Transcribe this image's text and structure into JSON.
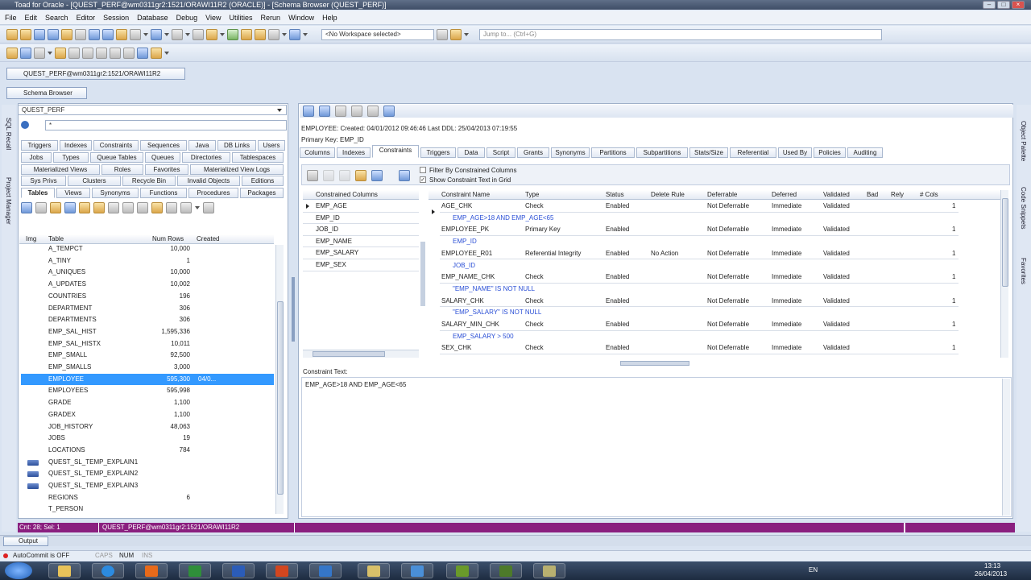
{
  "window": {
    "title": "Toad for Oracle - [QUEST_PERF@wm0311gr2:1521/ORAWI11R2 (ORACLE)] - [Schema Browser (QUEST_PERF)]"
  },
  "menu": [
    "File",
    "Edit",
    "Search",
    "Editor",
    "Session",
    "Database",
    "Debug",
    "View",
    "Utilities",
    "Rerun",
    "Window",
    "Help"
  ],
  "toolbar": {
    "workspace": "<No Workspace selected>",
    "jump_placeholder": "Jump to... (Ctrl+G)"
  },
  "connection_tab": "QUEST_PERF@wm0311gr2:1521/ORAWI11R2",
  "schema_browser_tab": "Schema Browser",
  "left": {
    "schema": "QUEST_PERF",
    "filter": "*",
    "obj_tabs_row1": [
      "Triggers",
      "Indexes",
      "Constraints",
      "Sequences",
      "Java",
      "DB Links",
      "Users"
    ],
    "obj_tabs_row2": [
      "Jobs",
      "Types",
      "Queue Tables",
      "Queues",
      "Directories",
      "Tablespaces"
    ],
    "obj_tabs_row3": [
      "Materialized Views",
      "Roles",
      "Favorites",
      "Materialized View Logs"
    ],
    "obj_tabs_row4": [
      "Sys Privs",
      "Clusters",
      "Recycle Bin",
      "Invalid Objects",
      "Editions"
    ],
    "obj_tabs_row5": [
      "Tables",
      "Views",
      "Synonyms",
      "Functions",
      "Procedures",
      "Packages"
    ],
    "cols": {
      "img": "Img",
      "table": "Table",
      "rows": "Num Rows",
      "created": "Created"
    },
    "tables": [
      {
        "name": "A_TEMPCT",
        "rows": "10,000",
        "created": ""
      },
      {
        "name": "A_TINY",
        "rows": "1",
        "created": ""
      },
      {
        "name": "A_UNIQUES",
        "rows": "10,000",
        "created": ""
      },
      {
        "name": "A_UPDATES",
        "rows": "10,002",
        "created": ""
      },
      {
        "name": "COUNTRIES",
        "rows": "196",
        "created": ""
      },
      {
        "name": "DEPARTMENT",
        "rows": "306",
        "created": ""
      },
      {
        "name": "DEPARTMENTS",
        "rows": "306",
        "created": ""
      },
      {
        "name": "EMP_SAL_HIST",
        "rows": "1,595,336",
        "created": ""
      },
      {
        "name": "EMP_SAL_HISTX",
        "rows": "10,011",
        "created": ""
      },
      {
        "name": "EMP_SMALL",
        "rows": "92,500",
        "created": ""
      },
      {
        "name": "EMP_SMALLS",
        "rows": "3,000",
        "created": ""
      },
      {
        "name": "EMPLOYEE",
        "rows": "595,300",
        "created": "04/0..."
      },
      {
        "name": "EMPLOYEES",
        "rows": "595,998",
        "created": ""
      },
      {
        "name": "GRADE",
        "rows": "1,100",
        "created": ""
      },
      {
        "name": "GRADEX",
        "rows": "1,100",
        "created": ""
      },
      {
        "name": "JOB_HISTORY",
        "rows": "48,063",
        "created": ""
      },
      {
        "name": "JOBS",
        "rows": "19",
        "created": ""
      },
      {
        "name": "LOCATIONS",
        "rows": "784",
        "created": ""
      },
      {
        "name": "QUEST_SL_TEMP_EXPLAIN1",
        "rows": "",
        "created": ""
      },
      {
        "name": "QUEST_SL_TEMP_EXPLAIN2",
        "rows": "",
        "created": ""
      },
      {
        "name": "QUEST_SL_TEMP_EXPLAIN3",
        "rows": "",
        "created": ""
      },
      {
        "name": "REGIONS",
        "rows": "6",
        "created": ""
      },
      {
        "name": "T_PERSON",
        "rows": "",
        "created": ""
      }
    ]
  },
  "right": {
    "info1": "EMPLOYEE:   Created: 04/01/2012 09:46:46   Last DDL: 25/04/2013 07:19:55",
    "info2": "Primary Key:  EMP_ID",
    "tabs": [
      "Columns",
      "Indexes",
      "Constraints",
      "Triggers",
      "Data",
      "Script",
      "Grants",
      "Synonyms",
      "Partitions",
      "Subpartitions",
      "Stats/Size",
      "Referential",
      "Used By",
      "Policies",
      "Auditing"
    ],
    "filter_label": "Filter By Constrained Columns",
    "show_text_label": "Show Constraint Text in Grid",
    "constrained_header": "Constrained Columns",
    "constrained_cols": [
      "EMP_AGE",
      "EMP_ID",
      "JOB_ID",
      "EMP_NAME",
      "EMP_SALARY",
      "EMP_SEX"
    ],
    "headers": {
      "name": "Constraint Name",
      "type": "Type",
      "status": "Status",
      "delete": "Delete Rule",
      "deferrable": "Deferrable",
      "deferred": "Deferred",
      "validated": "Validated",
      "bad": "Bad",
      "rely": "Rely",
      "cols": "# Cols"
    },
    "constraints": [
      {
        "name": "AGE_CHK",
        "type": "Check",
        "status": "Enabled",
        "delete": "",
        "deferrable": "Not Deferrable",
        "deferred": "Immediate",
        "validated": "Validated",
        "cols": "1",
        "text": "EMP_AGE>18 AND EMP_AGE<65"
      },
      {
        "name": "EMPLOYEE_PK",
        "type": "Primary Key",
        "status": "Enabled",
        "delete": "",
        "deferrable": "Not Deferrable",
        "deferred": "Immediate",
        "validated": "Validated",
        "cols": "1",
        "text": "EMP_ID"
      },
      {
        "name": "EMPLOYEE_R01",
        "type": "Referential Integrity",
        "status": "Enabled",
        "delete": "No Action",
        "deferrable": "Not Deferrable",
        "deferred": "Immediate",
        "validated": "Validated",
        "cols": "1",
        "text": "JOB_ID"
      },
      {
        "name": "EMP_NAME_CHK",
        "type": "Check",
        "status": "Enabled",
        "delete": "",
        "deferrable": "Not Deferrable",
        "deferred": "Immediate",
        "validated": "Validated",
        "cols": "1",
        "text": "\"EMP_NAME\" IS NOT NULL"
      },
      {
        "name": "SALARY_CHK",
        "type": "Check",
        "status": "Enabled",
        "delete": "",
        "deferrable": "Not Deferrable",
        "deferred": "Immediate",
        "validated": "Validated",
        "cols": "1",
        "text": "\"EMP_SALARY\" IS NOT NULL"
      },
      {
        "name": "SALARY_MIN_CHK",
        "type": "Check",
        "status": "Enabled",
        "delete": "",
        "deferrable": "Not Deferrable",
        "deferred": "Immediate",
        "validated": "Validated",
        "cols": "1",
        "text": "EMP_SALARY > 500"
      },
      {
        "name": "SEX_CHK",
        "type": "Check",
        "status": "Enabled",
        "delete": "",
        "deferrable": "Not Deferrable",
        "deferred": "Immediate",
        "validated": "Validated",
        "cols": "1",
        "text": ""
      }
    ],
    "text_label": "Constraint Text:",
    "text_value": "EMP_AGE>18 AND EMP_AGE<65"
  },
  "status": {
    "count": "Cnt: 28;  Sel: 1",
    "conn": "QUEST_PERF@wm0311gr2:1521/ORAWI11R2"
  },
  "output_tab": "Output",
  "bottom": {
    "autocommit": "AutoCommit is OFF",
    "caps": "CAPS",
    "num": "NUM",
    "ins": "INS"
  },
  "side_right": [
    "Object Palette",
    "Code Snippets",
    "Favorites"
  ],
  "side_left": [
    "SQL Recall",
    "Project Manager"
  ],
  "clock": {
    "time": "13:13",
    "date": "26/04/2013",
    "lang": "EN"
  },
  "colors": {
    "accent": "#8a1f7f",
    "selection": "#3399ff",
    "detail_text": "#2a4fd6"
  }
}
